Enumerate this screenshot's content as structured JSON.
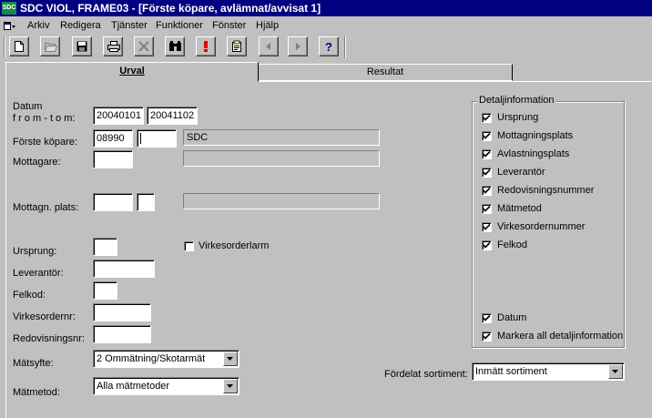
{
  "window": {
    "app_icon_text": "SDC",
    "title": "SDC VIOL, FRAME03 - [Förste köpare, avlämnat/avvisat 1]"
  },
  "menu": {
    "items": [
      {
        "label": "Arkiv"
      },
      {
        "label": "Redigera"
      },
      {
        "label": "Tjänster"
      },
      {
        "label": "Funktioner"
      },
      {
        "label": "Fönster"
      },
      {
        "label": "Hjälp"
      }
    ]
  },
  "toolbar": {
    "buttons": [
      "new-document-icon",
      "open-folder-icon",
      "save-icon",
      "print-icon",
      "delete-icon",
      "binoculars-icon",
      "exclamation-icon",
      "notes-icon",
      "arrow-left-icon",
      "arrow-right-icon",
      "help-icon"
    ]
  },
  "tabs": [
    {
      "label": "Urval"
    },
    {
      "label": "Resultat"
    }
  ],
  "form": {
    "datum_label_line1": "Datum",
    "datum_label_line2": "f r o m - t o m:",
    "datum_from": "20040101",
    "datum_tom": "20041102",
    "forste_kopare_label": "Förste köpare:",
    "forste_kopare_code": "08990",
    "forste_kopare_sub": "",
    "forste_kopare_name": "SDC",
    "mottagare_label": "Mottagare:",
    "mottagare_value": "",
    "mottagare_name": "",
    "mottagn_plats_label": "Mottagn. plats:",
    "mottagn_plats_value": "",
    "mottagn_plats_sub": "",
    "mottagn_plats_name": "",
    "ursprung_label": "Ursprung:",
    "ursprung_value": "",
    "virkesorderlarm_label": "Virkesorderlarm",
    "virkesorderlarm_checked": false,
    "leverantor_label": "Leverantör:",
    "leverantor_value": "",
    "felkod_label": "Felkod:",
    "felkod_value": "",
    "virkesordernr_label": "Virkesordernr:",
    "virkesordernr_value": "",
    "redovisningsnr_label": "Redovisningsnr:",
    "redovisningsnr_value": "",
    "matsyfte_label": "Mätsyfte:",
    "matsyfte_value": "2 Ommätning/Skotarmät",
    "matmetod_label": "Mätmetod:",
    "matmetod_value": "Alla mätmetoder",
    "fordelat_label": "Fördelat sortiment:",
    "fordelat_value": "Inmätt sortiment"
  },
  "detail": {
    "title": "Detaljinformation",
    "items": [
      {
        "label": "Ursprung",
        "checked": true
      },
      {
        "label": "Mottagningsplats",
        "checked": true
      },
      {
        "label": "Avlastningsplats",
        "checked": true
      },
      {
        "label": "Leverantör",
        "checked": true
      },
      {
        "label": "Redovisningsnummer",
        "checked": true
      },
      {
        "label": "Mätmetod",
        "checked": true
      },
      {
        "label": "Virkesordernummer",
        "checked": true
      },
      {
        "label": "Felkod",
        "checked": true
      }
    ],
    "datum_label": "Datum",
    "datum_checked": true,
    "markera_all_label": "Markera all detaljinformation",
    "markera_all_checked": true
  }
}
